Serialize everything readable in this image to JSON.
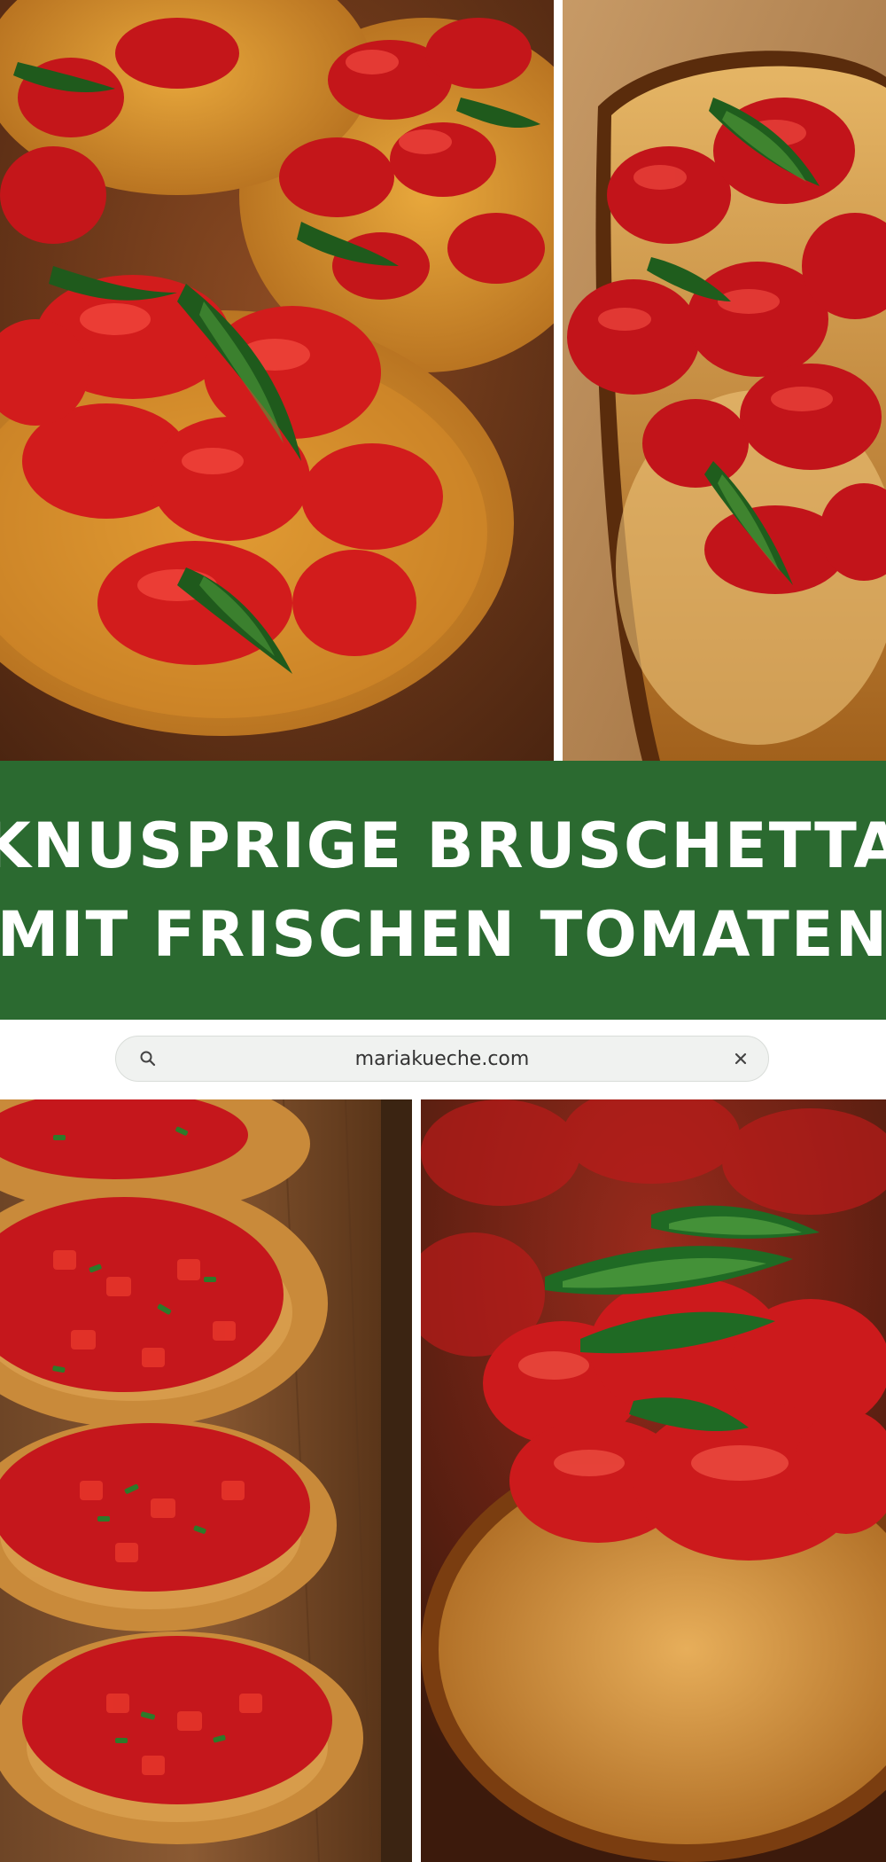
{
  "title": {
    "line1": "KNUSPRIGE BRUSCHETTA",
    "line2": "MIT FRISCHEN TOMATEN"
  },
  "url_bar": {
    "url": "mariakueche.com",
    "search_icon": "search-icon",
    "clear_icon": "close-icon"
  },
  "photos": [
    {
      "subject": "bruschetta-close-up"
    },
    {
      "subject": "bruschetta-single-slice"
    },
    {
      "subject": "bruschetta-on-board"
    },
    {
      "subject": "bruschetta-macro"
    }
  ],
  "colors": {
    "band_green": "#2b6a30",
    "title_text": "#ffffff",
    "url_bar_bg": "#f0f2f0"
  }
}
